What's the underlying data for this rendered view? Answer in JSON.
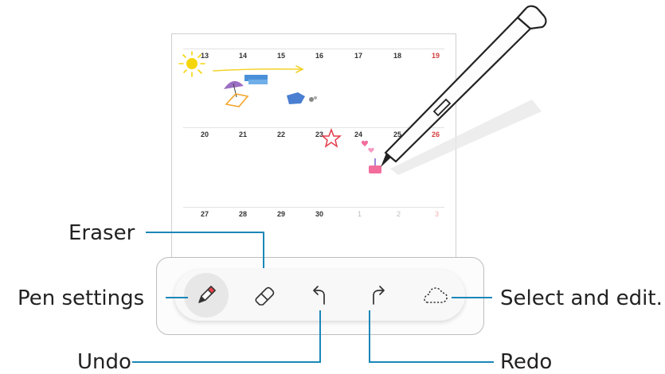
{
  "calendar": {
    "weeks": [
      [
        "13",
        "14",
        "15",
        "16",
        "17",
        "18",
        "19"
      ],
      [
        "20",
        "21",
        "22",
        "23",
        "24",
        "25",
        "26"
      ],
      [
        "27",
        "28",
        "29",
        "30",
        "1",
        "2",
        "3"
      ]
    ]
  },
  "toolbar": {
    "tools": [
      "Pen settings",
      "Eraser",
      "Undo",
      "Redo",
      "Select and edit."
    ]
  },
  "labels": {
    "eraser": "Eraser",
    "pen_settings": "Pen settings",
    "undo": "Undo",
    "redo": "Redo",
    "select_edit": "Select and edit."
  },
  "colors": {
    "callout_line": "#1a87b8",
    "sunday": "#d43f3f",
    "pen_tip": "#e8424a"
  }
}
